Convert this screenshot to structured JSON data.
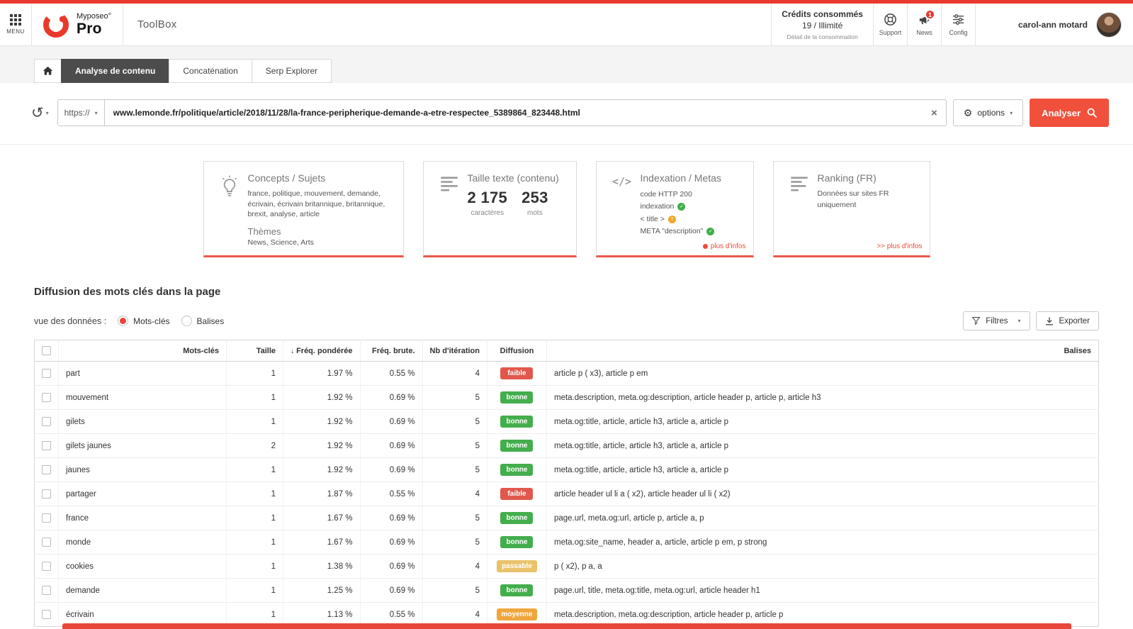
{
  "colors": {
    "accent": "#f0503c",
    "top_bar": "#e83b2d",
    "active_tab": "#4c4c4c",
    "badges": {
      "faible": "#e2574c",
      "bonne": "#44ad4c",
      "passable": "#e9c26a",
      "moyenne": "#f0a63c"
    },
    "status_ok": "#3fae49",
    "status_warn": "#f5a623"
  },
  "header": {
    "menu_label": "MENU",
    "brand_name": "Myposeo°",
    "brand_sub": "Pro",
    "app_title": "ToolBox",
    "credits_title": "Crédits consommés",
    "credits_value": "19 / Illimité",
    "credits_detail": "Détail de la consommation",
    "support_label": "Support",
    "news_label": "News",
    "news_badge": "1",
    "config_label": "Config",
    "user_name": "carol-ann motard"
  },
  "tabs": {
    "analyse": "Analyse de contenu",
    "concatenation": "Concaténation",
    "serp": "Serp Explorer"
  },
  "searchbar": {
    "protocol": "https://",
    "url": "www.lemonde.fr/politique/article/2018/11/28/la-france-peripherique-demande-a-etre-respectee_5389864_823448.html",
    "clear_glyph": "×",
    "options_label": "options",
    "analyse_label": "Analyser"
  },
  "cards": {
    "concepts": {
      "title": "Concepts / Sujets",
      "keywords": "france, politique, mouvement, demande, écrivain, écrivain britannique, britannique, brexit, analyse, article",
      "themes_title": "Thèmes",
      "themes": "News, Science, Arts"
    },
    "size": {
      "title": "Taille texte (contenu)",
      "chars_value": "2 175",
      "chars_label": "caractères",
      "words_value": "253",
      "words_label": "mots"
    },
    "indexation": {
      "title": "Indexation / Metas",
      "http_line": "code HTTP  200",
      "indexation_label": "indexation",
      "title_tag_label": "< title >",
      "meta_label": "META \"description\"",
      "more_label": "plus d'infos"
    },
    "ranking": {
      "title": "Ranking (FR)",
      "subtitle": "Données sur sites FR uniquement",
      "more_label": ">> plus d'infos"
    }
  },
  "section": {
    "title": "Diffusion des mots clés dans la page",
    "view_label": "vue des données :",
    "radio_keywords": "Mots-clés",
    "radio_tags": "Balises",
    "filters_label": "Filtres",
    "export_label": "Exporter"
  },
  "table": {
    "headers": [
      "Mots-clés",
      "Taille",
      "Fréq. pondérée",
      "Fréq. brute.",
      "Nb d'itération",
      "Diffusion",
      "Balises"
    ],
    "sort_arrow": "↓",
    "rows": [
      {
        "keyword": "part",
        "taille": "1",
        "freq_ponderee": "1.97 %",
        "freq_brute": "0.55 %",
        "iterations": "4",
        "diffusion": "faible",
        "balises": "article p ( x3), article p em"
      },
      {
        "keyword": "mouvement",
        "taille": "1",
        "freq_ponderee": "1.92 %",
        "freq_brute": "0.69 %",
        "iterations": "5",
        "diffusion": "bonne",
        "balises": "meta.description, meta.og:description, article header p, article p, article h3"
      },
      {
        "keyword": "gilets",
        "taille": "1",
        "freq_ponderee": "1.92 %",
        "freq_brute": "0.69 %",
        "iterations": "5",
        "diffusion": "bonne",
        "balises": "meta.og:title, article, article h3, article a, article p"
      },
      {
        "keyword": "gilets jaunes",
        "taille": "2",
        "freq_ponderee": "1.92 %",
        "freq_brute": "0.69 %",
        "iterations": "5",
        "diffusion": "bonne",
        "balises": "meta.og:title, article, article h3, article a, article p"
      },
      {
        "keyword": "jaunes",
        "taille": "1",
        "freq_ponderee": "1.92 %",
        "freq_brute": "0.69 %",
        "iterations": "5",
        "diffusion": "bonne",
        "balises": "meta.og:title, article, article h3, article a, article p"
      },
      {
        "keyword": "partager",
        "taille": "1",
        "freq_ponderee": "1.87 %",
        "freq_brute": "0.55 %",
        "iterations": "4",
        "diffusion": "faible",
        "balises": "article header ul li a ( x2), article header ul li ( x2)"
      },
      {
        "keyword": "france",
        "taille": "1",
        "freq_ponderee": "1.67 %",
        "freq_brute": "0.69 %",
        "iterations": "5",
        "diffusion": "bonne",
        "balises": "page.url, meta.og:url, article p, article a, p"
      },
      {
        "keyword": "monde",
        "taille": "1",
        "freq_ponderee": "1.67 %",
        "freq_brute": "0.69 %",
        "iterations": "5",
        "diffusion": "bonne",
        "balises": "meta.og:site_name, header a, article, article p em, p strong"
      },
      {
        "keyword": "cookies",
        "taille": "1",
        "freq_ponderee": "1.38 %",
        "freq_brute": "0.69 %",
        "iterations": "4",
        "diffusion": "passable",
        "balises": "p ( x2), p a, a"
      },
      {
        "keyword": "demande",
        "taille": "1",
        "freq_ponderee": "1.25 %",
        "freq_brute": "0.69 %",
        "iterations": "5",
        "diffusion": "bonne",
        "balises": "page.url, title, meta.og:title, meta.og:url, article header h1"
      },
      {
        "keyword": "écrivain",
        "taille": "1",
        "freq_ponderee": "1.13 %",
        "freq_brute": "0.55 %",
        "iterations": "4",
        "diffusion": "moyenne",
        "balises": "meta.description, meta.og:description, article header p, article p"
      }
    ]
  }
}
